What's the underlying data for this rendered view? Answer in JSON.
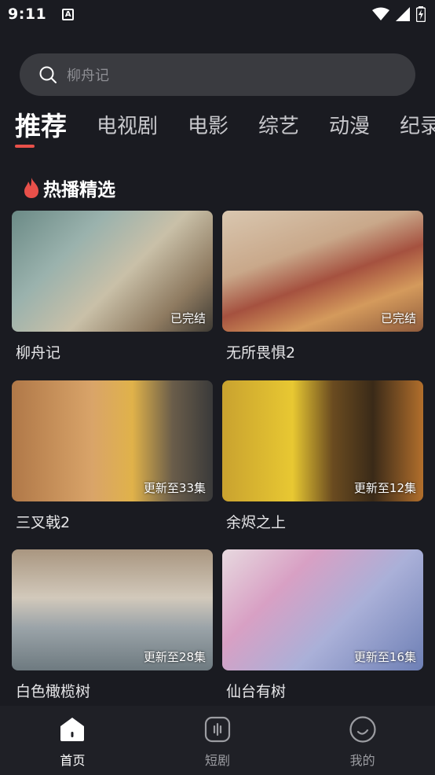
{
  "status_bar": {
    "time": "9:11",
    "notification_glyph": "A"
  },
  "search": {
    "placeholder": "柳舟记"
  },
  "tabs": [
    {
      "label": "推荐",
      "active": true
    },
    {
      "label": "电视剧",
      "active": false
    },
    {
      "label": "电影",
      "active": false
    },
    {
      "label": "综艺",
      "active": false
    },
    {
      "label": "动漫",
      "active": false
    },
    {
      "label": "纪录",
      "active": false
    }
  ],
  "section": {
    "title": "热播精选",
    "icon": "flame-icon",
    "accent": "#e8504a"
  },
  "cards": [
    {
      "title": "柳舟记",
      "badge": "已完结"
    },
    {
      "title": "无所畏惧2",
      "badge": "已完结"
    },
    {
      "title": "三叉戟2",
      "badge": "更新至33集"
    },
    {
      "title": "余烬之上",
      "badge": "更新至12集"
    },
    {
      "title": "白色橄榄树",
      "badge": "更新至28集"
    },
    {
      "title": "仙台有树",
      "badge": "更新至16集"
    }
  ],
  "bottom_nav": [
    {
      "label": "首页",
      "icon": "home-icon",
      "active": true
    },
    {
      "label": "短剧",
      "icon": "short-drama-icon",
      "active": false
    },
    {
      "label": "我的",
      "icon": "profile-icon",
      "active": false
    }
  ]
}
